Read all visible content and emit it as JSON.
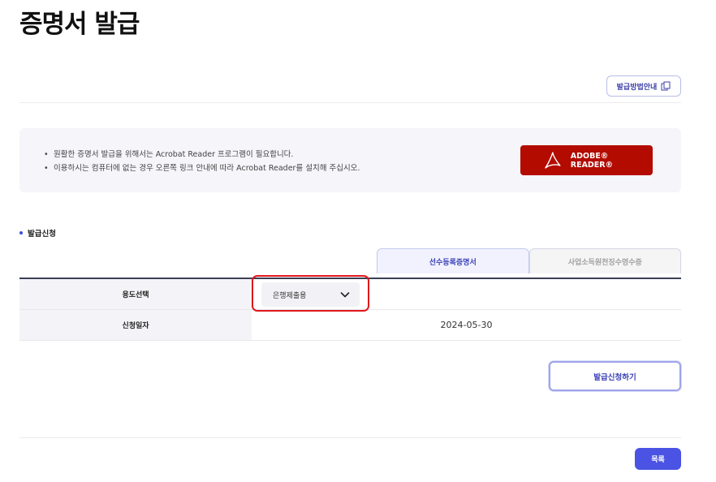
{
  "page": {
    "title": "증명서 발급"
  },
  "guide_button": {
    "label": "발급방법안내",
    "icon": "copy-document-icon"
  },
  "notice": {
    "items": [
      "원활한 증명서 발급을 위해서는 Acrobat Reader 프로그램이 필요합니다.",
      "이용하시는 컴퓨터에 없는 경우 오른쪽 링크 안내에 따라 Acrobat Reader를 설치해 주십시오."
    ],
    "adobe_button": {
      "label": "ADOBE® READER®",
      "icon": "adobe-acrobat-icon",
      "color": "#b30b00"
    }
  },
  "section": {
    "label": "발급신청"
  },
  "tabs": [
    {
      "label": "선수등록증명서",
      "active": true
    },
    {
      "label": "사업소득원천징수영수증",
      "active": false
    }
  ],
  "form": {
    "rows": [
      {
        "label": "용도선택",
        "select_value": "은행제출용"
      },
      {
        "label": "신청일자",
        "value": "2024-05-30"
      }
    ]
  },
  "apply_button": {
    "label": "발급신청하기"
  },
  "list_button": {
    "label": "목록",
    "color": "#4b53e4"
  },
  "colors": {
    "accent": "#3b40b8",
    "highlight": "#e0171b"
  }
}
